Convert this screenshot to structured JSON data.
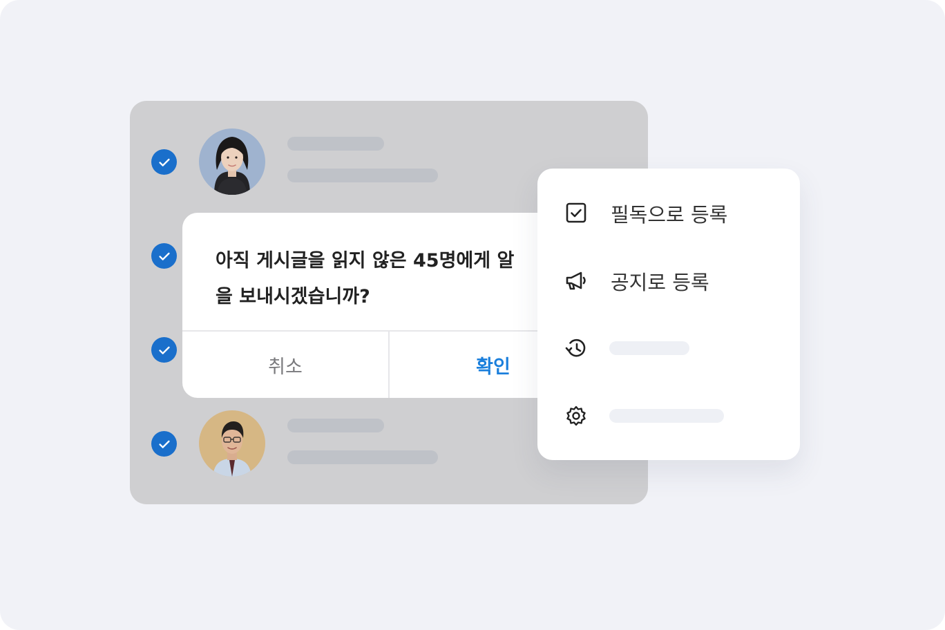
{
  "colors": {
    "background": "#f1f2f7",
    "list_panel": "#cfcfd1",
    "check": "#1a6fcb",
    "confirm_text": "#1a7fdc",
    "placeholder_bar": "#bfc2c8",
    "menu_placeholder_bar": "#eef0f5"
  },
  "list": {
    "rows": [
      {
        "checked": true,
        "avatar": "woman-avatar"
      },
      {
        "checked": true
      },
      {
        "checked": true
      },
      {
        "checked": true,
        "avatar": "man-avatar"
      }
    ]
  },
  "dialog": {
    "message_line1": "아직 게시글을 읽지 않은 45명에게 알",
    "message_line2": "을 보내시겠습니까?",
    "cancel_label": "취소",
    "confirm_label": "확인"
  },
  "menu": {
    "items": [
      {
        "icon": "checkbox-icon",
        "label": "필독으로 등록"
      },
      {
        "icon": "megaphone-icon",
        "label": "공지로 등록"
      },
      {
        "icon": "history-icon",
        "label": ""
      },
      {
        "icon": "gear-icon",
        "label": ""
      }
    ]
  }
}
